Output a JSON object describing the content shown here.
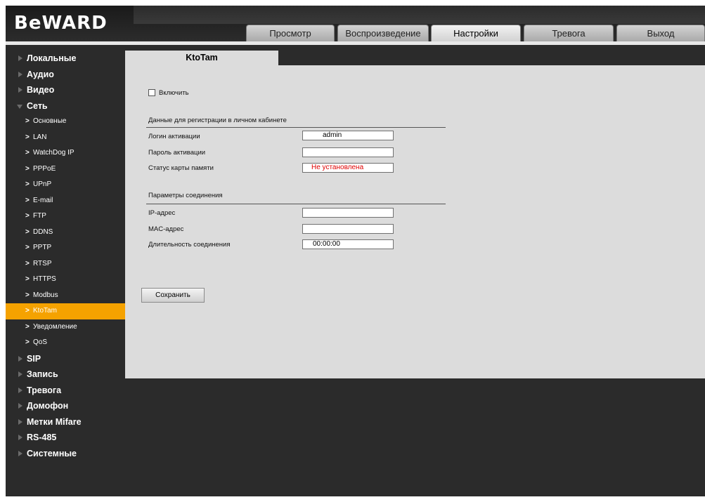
{
  "header": {
    "logo": "BeWARD",
    "nav_tabs": [
      {
        "label": "Просмотр",
        "active": false
      },
      {
        "label": "Воспроизведение",
        "active": false
      },
      {
        "label": "Настройки",
        "active": true
      },
      {
        "label": "Тревога",
        "active": false
      },
      {
        "label": "Выход",
        "active": false
      }
    ]
  },
  "sidebar": {
    "items": [
      {
        "label": "Локальные",
        "expanded": false
      },
      {
        "label": "Аудио",
        "expanded": false
      },
      {
        "label": "Видео",
        "expanded": false
      },
      {
        "label": "Сеть",
        "expanded": true,
        "children": [
          {
            "label": "Основные",
            "active": false
          },
          {
            "label": "LAN",
            "active": false
          },
          {
            "label": "WatchDog IP",
            "active": false
          },
          {
            "label": "PPPoE",
            "active": false
          },
          {
            "label": "UPnP",
            "active": false
          },
          {
            "label": "E-mail",
            "active": false
          },
          {
            "label": "FTP",
            "active": false
          },
          {
            "label": "DDNS",
            "active": false
          },
          {
            "label": "PPTP",
            "active": false
          },
          {
            "label": "RTSP",
            "active": false
          },
          {
            "label": "HTTPS",
            "active": false
          },
          {
            "label": "Modbus",
            "active": false
          },
          {
            "label": "KtoTam",
            "active": true
          },
          {
            "label": "Уведомление",
            "active": false
          },
          {
            "label": "QoS",
            "active": false
          }
        ]
      },
      {
        "label": "SIP",
        "expanded": false
      },
      {
        "label": "Запись",
        "expanded": false
      },
      {
        "label": "Тревога",
        "expanded": false
      },
      {
        "label": "Домофон",
        "expanded": false
      },
      {
        "label": "Метки Mifare",
        "expanded": false
      },
      {
        "label": "RS-485",
        "expanded": false
      },
      {
        "label": "Системные",
        "expanded": false
      }
    ]
  },
  "content": {
    "tab_title": "KtoTam",
    "enable": {
      "label": "Включить",
      "checked": false
    },
    "registration": {
      "title": "Данные для регистрации в личном кабинете",
      "login_label": "Логин активации",
      "login_value": "admin",
      "password_label": "Пароль активации",
      "password_value": "",
      "sd_label": "Статус карты памяти",
      "sd_value": "Не установлена"
    },
    "connection": {
      "title": "Параметры соединения",
      "ip_label": "IP-адрес",
      "ip_value": "",
      "mac_label": "MAC-адрес",
      "mac_value": "",
      "duration_label": "Длительность соединения",
      "duration_value": "00:00:00"
    },
    "save_label": "Сохранить"
  },
  "colors": {
    "background": "#2b2b2b",
    "content_bg": "#dcdcdc",
    "active_item": "#f5a200",
    "status_red": "#e00000"
  }
}
